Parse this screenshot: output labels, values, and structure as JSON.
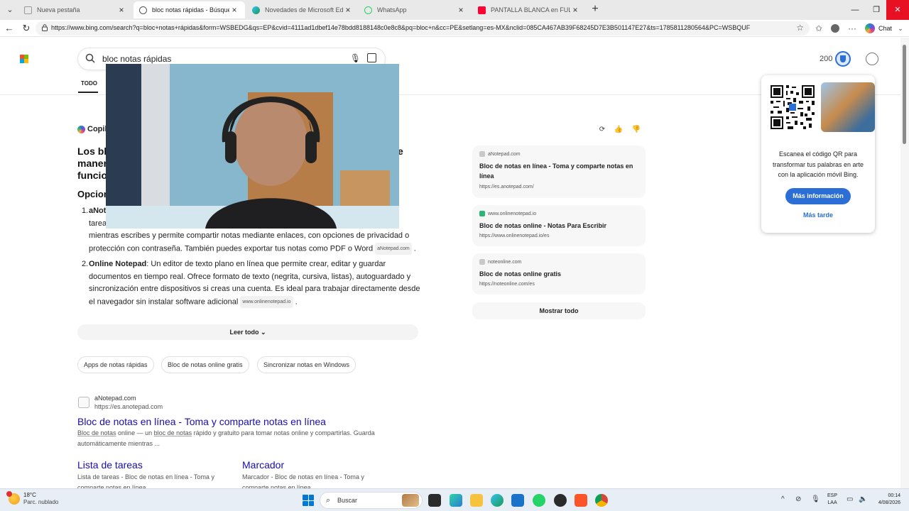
{
  "browser": {
    "tabs": [
      {
        "label": "Nueva pestaña",
        "active": false
      },
      {
        "label": "bloc notas rápidas - Búsqueda",
        "active": true
      },
      {
        "label": "Novedades de Microsoft Edge",
        "active": false
      },
      {
        "label": "WhatsApp",
        "active": false
      },
      {
        "label": "PANTALLA BLANCA en FULL HD L",
        "active": false
      }
    ],
    "url": "https://www.bing.com/search?q=bloc+notas+rápidas&form=WSBEDG&qs=EP&cvid=4111ad1dbef14e78bdd8188148c0e8c8&pq=bloc+n&cc=PE&setlang=es-MX&nclid=085CA467AB39F68245D7E3B501147E27&ts=1785811280564&PC=WSBQUF",
    "chat_label": "Chat"
  },
  "bing": {
    "query": "bloc notas rápidas",
    "points": "200",
    "nav_tab": "TODO",
    "copilot_label": "Copilot",
    "answer": {
      "heading_part1": "Los bloc",
      "heading_part2": "manera",
      "heading_part3": "funcion",
      "heading_right": "e",
      "subheading": "Opcion",
      "items": [
        {
          "num": "1.",
          "line1_bold": "aNot",
          "line1_rest": "de",
          "line2": "tarea",
          "line2_right": "te",
          "line3": "mientras escribes y permite compartir notas mediante enlaces, con opciones de privacidad o",
          "line4": "protección con contraseña. También puedes exportar tus notas como PDF o Word",
          "cite": "aNotepad.com"
        },
        {
          "num": "2.",
          "bold": "Online Notepad",
          "text": ": Un editor de texto plano en línea que permite crear, editar y guardar documentos en tiempo real. Ofrece formato de texto (negrita, cursiva, listas), autoguardado y sincronización entre dispositivos si creas una cuenta. Es ideal para trabajar directamente desde el navegador sin instalar software adicional",
          "cite": "www.onlinenotepad.io"
        }
      ],
      "read_all": "Leer todo"
    },
    "chips": [
      "Apps de notas rápidas",
      "Bloc de notas online gratis",
      "Sincronizar notas en Windows"
    ],
    "sources": [
      {
        "domain": "aNotepad.com",
        "title": "Bloc de notas en línea - Toma y comparte notas en línea",
        "url": "https://es.anotepad.com/"
      },
      {
        "domain": "www.onlinenotepad.io",
        "title": "Bloc de notas online - Notas Para Escribir",
        "url": "https://www.onlinenotepad.io/es"
      },
      {
        "domain": "noteonline.com",
        "title": "Bloc de notas online gratis",
        "url": "https://noteonline.com/es"
      }
    ],
    "show_all": "Mostrar todo",
    "result": {
      "site": "aNotepad.com",
      "url": "https://es.anotepad.com",
      "title": "Bloc de notas en línea - Toma y comparte notas en línea",
      "snippet_a": "Bloc de notas",
      "snippet_b": " online — un ",
      "snippet_c": "bloc de notas",
      "snippet_d": " rápido y gratuito para tomar notas online y compartirlas. Guarda automáticamente mientras ...",
      "sublinks": [
        {
          "title": "Lista de tareas",
          "snippet": "Lista de tareas - Bloc de notas en línea - Toma y comparte notas en línea"
        },
        {
          "title": "Marcador",
          "snippet": "Marcador - Bloc de notas en línea - Toma y comparte notas en línea"
        }
      ]
    },
    "qr_popup": {
      "text": "Escanea el código QR para transformar tus palabras en arte con la aplicación móvil Bing.",
      "more": "Más información",
      "later": "Más tarde"
    }
  },
  "taskbar": {
    "temp": "18°C",
    "condition": "Parc. nublado",
    "search": "Buscar",
    "lang1": "ESP",
    "lang2": "LAA",
    "time": "00:14",
    "date": "4/08/2026"
  },
  "colors": {
    "accent": "#2b6ed6",
    "link": "#1a0dab",
    "close": "#e81123"
  }
}
